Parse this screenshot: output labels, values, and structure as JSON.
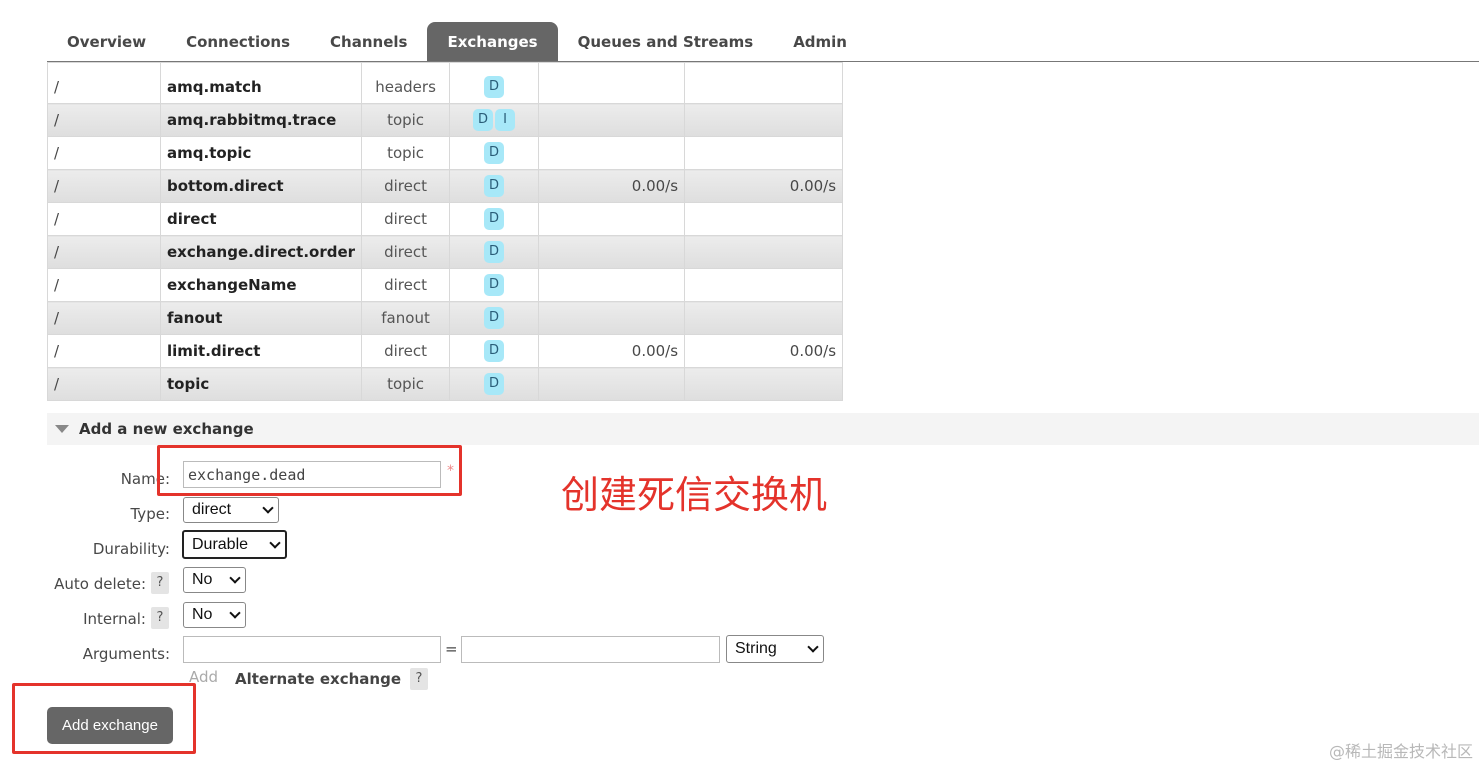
{
  "nav": {
    "tabs": [
      {
        "label": "Overview",
        "active": false
      },
      {
        "label": "Connections",
        "active": false
      },
      {
        "label": "Channels",
        "active": false
      },
      {
        "label": "Exchanges",
        "active": true
      },
      {
        "label": "Queues and Streams",
        "active": false
      },
      {
        "label": "Admin",
        "active": false
      }
    ]
  },
  "exchanges": {
    "rows": [
      {
        "vhost": "/",
        "name": "amq.match",
        "type": "headers",
        "features": [
          "D"
        ],
        "rate_in": "",
        "rate_out": ""
      },
      {
        "vhost": "/",
        "name": "amq.rabbitmq.trace",
        "type": "topic",
        "features": [
          "D",
          "I"
        ],
        "rate_in": "",
        "rate_out": ""
      },
      {
        "vhost": "/",
        "name": "amq.topic",
        "type": "topic",
        "features": [
          "D"
        ],
        "rate_in": "",
        "rate_out": ""
      },
      {
        "vhost": "/",
        "name": "bottom.direct",
        "type": "direct",
        "features": [
          "D"
        ],
        "rate_in": "0.00/s",
        "rate_out": "0.00/s"
      },
      {
        "vhost": "/",
        "name": "direct",
        "type": "direct",
        "features": [
          "D"
        ],
        "rate_in": "",
        "rate_out": ""
      },
      {
        "vhost": "/",
        "name": "exchange.direct.order",
        "type": "direct",
        "features": [
          "D"
        ],
        "rate_in": "",
        "rate_out": ""
      },
      {
        "vhost": "/",
        "name": "exchangeName",
        "type": "direct",
        "features": [
          "D"
        ],
        "rate_in": "",
        "rate_out": ""
      },
      {
        "vhost": "/",
        "name": "fanout",
        "type": "fanout",
        "features": [
          "D"
        ],
        "rate_in": "",
        "rate_out": ""
      },
      {
        "vhost": "/",
        "name": "limit.direct",
        "type": "direct",
        "features": [
          "D"
        ],
        "rate_in": "0.00/s",
        "rate_out": "0.00/s"
      },
      {
        "vhost": "/",
        "name": "topic",
        "type": "topic",
        "features": [
          "D"
        ],
        "rate_in": "",
        "rate_out": ""
      }
    ]
  },
  "form": {
    "section_title": "Add a new exchange",
    "name_label": "Name:",
    "name_value": "exchange.dead",
    "required_mark": "*",
    "type_label": "Type:",
    "type_value": "direct",
    "durability_label": "Durability:",
    "durability_value": "Durable",
    "auto_delete_label": "Auto delete:",
    "auto_delete_value": "No",
    "internal_label": "Internal:",
    "internal_value": "No",
    "arguments_label": "Arguments:",
    "arguments_key": "",
    "arguments_equals": "=",
    "arguments_value": "",
    "arguments_type": "String",
    "add_link": "Add",
    "alternate_exchange": "Alternate exchange",
    "help_glyph": "?",
    "submit_label": "Add exchange"
  },
  "annotation": {
    "text": "创建死信交换机",
    "color": "#e4332b"
  },
  "watermark": "@稀土掘金技术社区"
}
